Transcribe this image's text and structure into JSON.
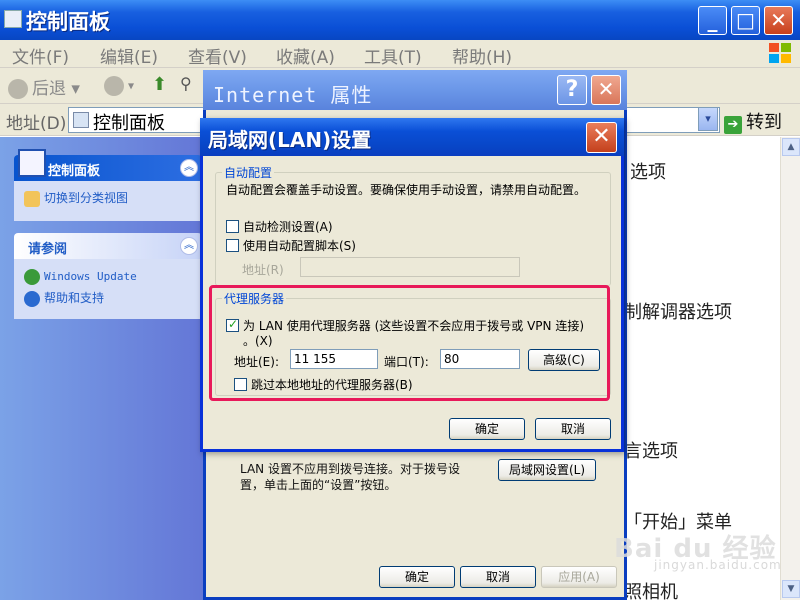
{
  "window": {
    "title": "控制面板",
    "buttons": {
      "minimize": "_",
      "maximize": "□",
      "close": "✕"
    }
  },
  "menu": [
    "文件(F)",
    "编辑(E)",
    "查看(V)",
    "收藏(A)",
    "工具(T)",
    "帮助(H)"
  ],
  "toolbar": {
    "back": "后退"
  },
  "address": {
    "label": "地址(D)",
    "value": "控制面板",
    "go": "转到"
  },
  "left_pane": {
    "panel1": {
      "title": "控制面板",
      "link": "切换到分类视图"
    },
    "panel2": {
      "title": "请参阅",
      "links": [
        "Windows Update",
        "帮助和支持"
      ]
    }
  },
  "background_right": [
    "选项",
    "制解调器选项",
    "言选项",
    "「开始」菜单",
    "照相机"
  ],
  "internet_properties": {
    "title": "Internet 属性",
    "lan_text_line1": "LAN 设置不应用到拨号连接。对于拨号设",
    "lan_text_line2": "置，单击上面的“设置”按钮。",
    "lan_button": "局域网设置(L)",
    "ok": "确定",
    "cancel": "取消",
    "apply": "应用(A)"
  },
  "lan_dialog": {
    "title": "局域网(LAN)设置",
    "auto_config": {
      "group_label": "自动配置",
      "description": "自动配置会覆盖手动设置。要确保使用手动设置，请禁用自动配置。",
      "auto_detect": {
        "label": "自动检测设置(A)",
        "checked": false
      },
      "use_script": {
        "label": "使用自动配置脚本(S)",
        "checked": false
      },
      "address_label": "地址(R)",
      "address_value": ""
    },
    "proxy": {
      "group_label": "代理服务器",
      "use_proxy_line1": "为 LAN 使用代理服务器 (这些设置不会应用于拨号或 VPN 连接)",
      "use_proxy_line2": "。(X)",
      "use_proxy_checked": true,
      "address_label": "地址(E):",
      "address_value": "11              155",
      "port_label": "端口(T):",
      "port_value": "80",
      "advanced": "高级(C)",
      "bypass": {
        "label": "跳过本地地址的代理服务器(B)",
        "checked": false
      }
    },
    "ok": "确定",
    "cancel": "取消"
  },
  "watermark": {
    "main": "Bai du 经验",
    "sub": "jingyan.baidu.com"
  },
  "colors": {
    "xp_blue": "#0a4fd6",
    "highlight": "#e8195a",
    "dialog_bg": "#ece9d8"
  }
}
